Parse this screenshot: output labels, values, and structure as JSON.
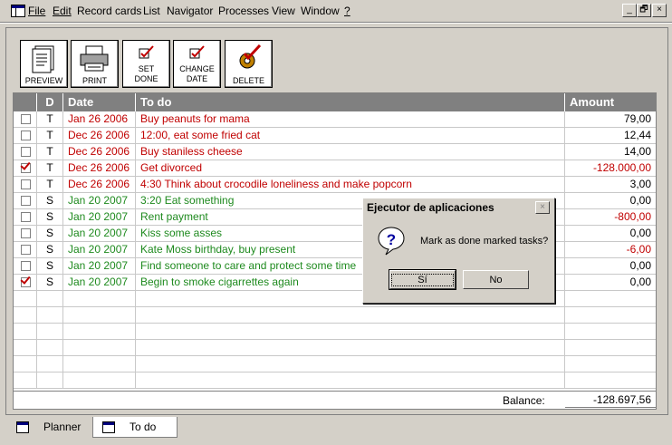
{
  "menu": {
    "items": [
      {
        "label": "File"
      },
      {
        "label": "Edit"
      },
      {
        "label": "Record cards"
      },
      {
        "label": "List"
      },
      {
        "label": "Navigator"
      },
      {
        "label": "Processes"
      },
      {
        "label": "View"
      },
      {
        "label": "Window"
      },
      {
        "label": "?"
      }
    ],
    "window_buttons": {
      "minimize": "_",
      "restore": "🗗",
      "close": "×"
    }
  },
  "toolbar": {
    "preview": "PREVIEW",
    "print": "PRINT",
    "set_done_1": "SET",
    "set_done_2": "DONE",
    "change_date_1": "CHANGE",
    "change_date_2": "DATE",
    "delete": "DELETE"
  },
  "grid": {
    "headers": {
      "check": "",
      "d": "D",
      "date": "Date",
      "todo": "To do",
      "amount": "Amount"
    },
    "rows": [
      {
        "checked": false,
        "d": "T",
        "date": "Jan 26 2006",
        "todo": "Buy peanuts for mama",
        "amount": "79,00",
        "color": "red",
        "amount_color": "black"
      },
      {
        "checked": false,
        "d": "T",
        "date": "Dec 26 2006",
        "todo": "12:00, eat some fried cat",
        "amount": "12,44",
        "color": "red",
        "amount_color": "black"
      },
      {
        "checked": false,
        "d": "T",
        "date": "Dec 26 2006",
        "todo": "Buy staniless cheese",
        "amount": "14,00",
        "color": "red",
        "amount_color": "black"
      },
      {
        "checked": true,
        "d": "T",
        "date": "Dec 26 2006",
        "todo": "Get divorced",
        "amount": "-128.000,00",
        "color": "red",
        "amount_color": "red"
      },
      {
        "checked": false,
        "d": "T",
        "date": "Dec 26 2006",
        "todo": "4:30 Think about crocodile loneliness and make popcorn",
        "amount": "3,00",
        "color": "red",
        "amount_color": "black"
      },
      {
        "checked": false,
        "d": "S",
        "date": "Jan 20 2007",
        "todo": "3:20 Eat something",
        "amount": "0,00",
        "color": "green",
        "amount_color": "black"
      },
      {
        "checked": false,
        "d": "S",
        "date": "Jan 20 2007",
        "todo": "Rent payment",
        "amount": "-800,00",
        "color": "green",
        "amount_color": "red"
      },
      {
        "checked": false,
        "d": "S",
        "date": "Jan 20 2007",
        "todo": "Kiss some asses",
        "amount": "0,00",
        "color": "green",
        "amount_color": "black"
      },
      {
        "checked": false,
        "d": "S",
        "date": "Jan 20 2007",
        "todo": "Kate Moss birthday, buy present",
        "amount": "-6,00",
        "color": "green",
        "amount_color": "red"
      },
      {
        "checked": false,
        "d": "S",
        "date": "Jan 20 2007",
        "todo": "Find someone to care and protect some time",
        "amount": "0,00",
        "color": "green",
        "amount_color": "black"
      },
      {
        "checked": true,
        "d": "S",
        "date": "Jan 20 2007",
        "todo": "Begin to smoke cigarrettes again",
        "amount": "0,00",
        "color": "green",
        "amount_color": "black"
      }
    ],
    "balance_label": "Balance:",
    "balance_value": "-128.697,56"
  },
  "tabs": [
    {
      "label": "Planner",
      "active": false
    },
    {
      "label": "To do",
      "active": true
    }
  ],
  "dialog": {
    "title": "Ejecutor de aplicaciones",
    "message": "Mark as done marked tasks?",
    "yes": "Sí",
    "no": "No",
    "close": "×"
  },
  "colors": {
    "red": "#c00000",
    "green": "#1e8a1e",
    "header": "#808080",
    "face": "#d4d0c8"
  }
}
